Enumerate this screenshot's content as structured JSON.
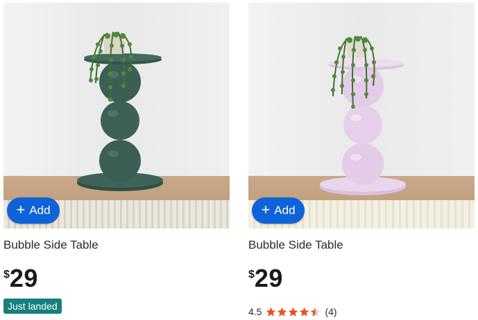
{
  "colors": {
    "add_button": "#0e63d9",
    "badge": "#16807d",
    "star": "#e8531e",
    "table_green": "#3c5e54",
    "table_lilac": "#e4cbe8"
  },
  "products": [
    {
      "image_alt": "green-table",
      "add_label": "Add",
      "add_icon": "plus-icon",
      "title": "Bubble Side Table",
      "currency": "$",
      "price": "29",
      "badge": "Just landed"
    },
    {
      "image_alt": "lilac-table",
      "add_label": "Add",
      "add_icon": "plus-icon",
      "title": "Bubble Side Table",
      "currency": "$",
      "price": "29",
      "rating_value": "4.5",
      "rating_stars": 4.5,
      "rating_count": "(4)"
    }
  ]
}
